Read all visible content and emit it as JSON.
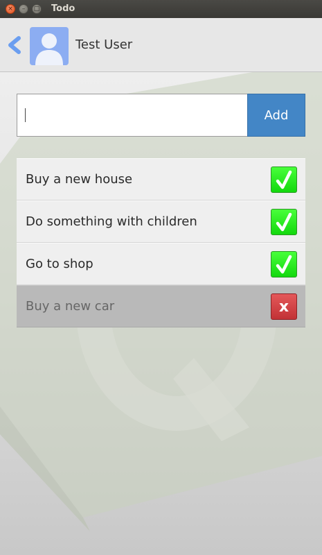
{
  "window": {
    "title": "Todo",
    "controls": {
      "close_glyph": "×",
      "min_glyph": "–",
      "max_glyph": "□"
    }
  },
  "header": {
    "username": "Test User",
    "back_icon": "chevron-left-icon",
    "avatar_icon": "user-avatar-icon"
  },
  "new_item": {
    "value": "",
    "placeholder": "",
    "add_label": "Add"
  },
  "todos": [
    {
      "text": "Buy a new house",
      "state": "active",
      "action_icon": "checkmark-icon"
    },
    {
      "text": "Do something with children",
      "state": "active",
      "action_icon": "checkmark-icon"
    },
    {
      "text": "Go to shop",
      "state": "active",
      "action_icon": "checkmark-icon"
    },
    {
      "text": "Buy a new car",
      "state": "done",
      "action_icon": "cross-icon",
      "action_glyph": "x"
    }
  ],
  "colors": {
    "accent": "#4386c6",
    "check_green": "#1ee815",
    "delete_red": "#d0393c",
    "avatar": "#8cadf2",
    "back_arrow": "#6b9ef0"
  }
}
